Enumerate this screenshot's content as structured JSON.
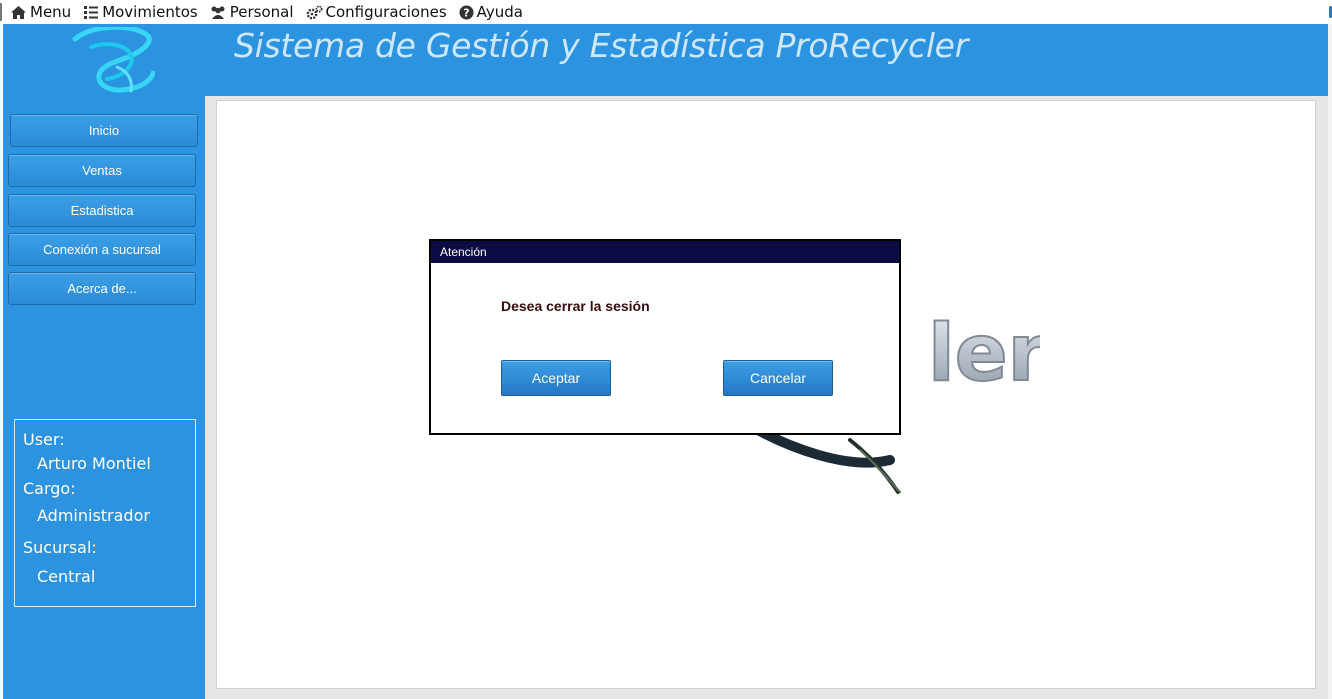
{
  "menubar": {
    "items": [
      {
        "label": "Menu",
        "icon": "home-icon"
      },
      {
        "label": "Movimientos",
        "icon": "list-icon"
      },
      {
        "label": "Personal",
        "icon": "people-icon"
      },
      {
        "label": "Configuraciones",
        "icon": "gears-icon"
      },
      {
        "label": "Ayuda",
        "icon": "help-icon"
      }
    ]
  },
  "header": {
    "title": "Sistema de Gestión y Estadística ProRecycler",
    "logo_icon": "prorecycler-logo-icon"
  },
  "sidebar": {
    "items": [
      {
        "label": "Inicio"
      },
      {
        "label": "Ventas"
      },
      {
        "label": "Estadistica"
      },
      {
        "label": "Conexión a sucursal"
      },
      {
        "label": "Acerca de..."
      }
    ],
    "user_box": {
      "user_label": "User:",
      "user_value": "Arturo Montiel",
      "cargo_label": "Cargo:",
      "cargo_value": "Administrador",
      "sucursal_label": "Sucursal:",
      "sucursal_value": "Central"
    }
  },
  "background": {
    "watermark_text": "ler"
  },
  "dialog": {
    "title": "Atención",
    "message": "Desea cerrar la sesión",
    "accept_label": "Aceptar",
    "cancel_label": "Cancelar"
  },
  "colors": {
    "brand_blue": "#2b93e0",
    "dialog_title_bg": "#0b0b45",
    "button_blue": "#2a8bd7"
  }
}
